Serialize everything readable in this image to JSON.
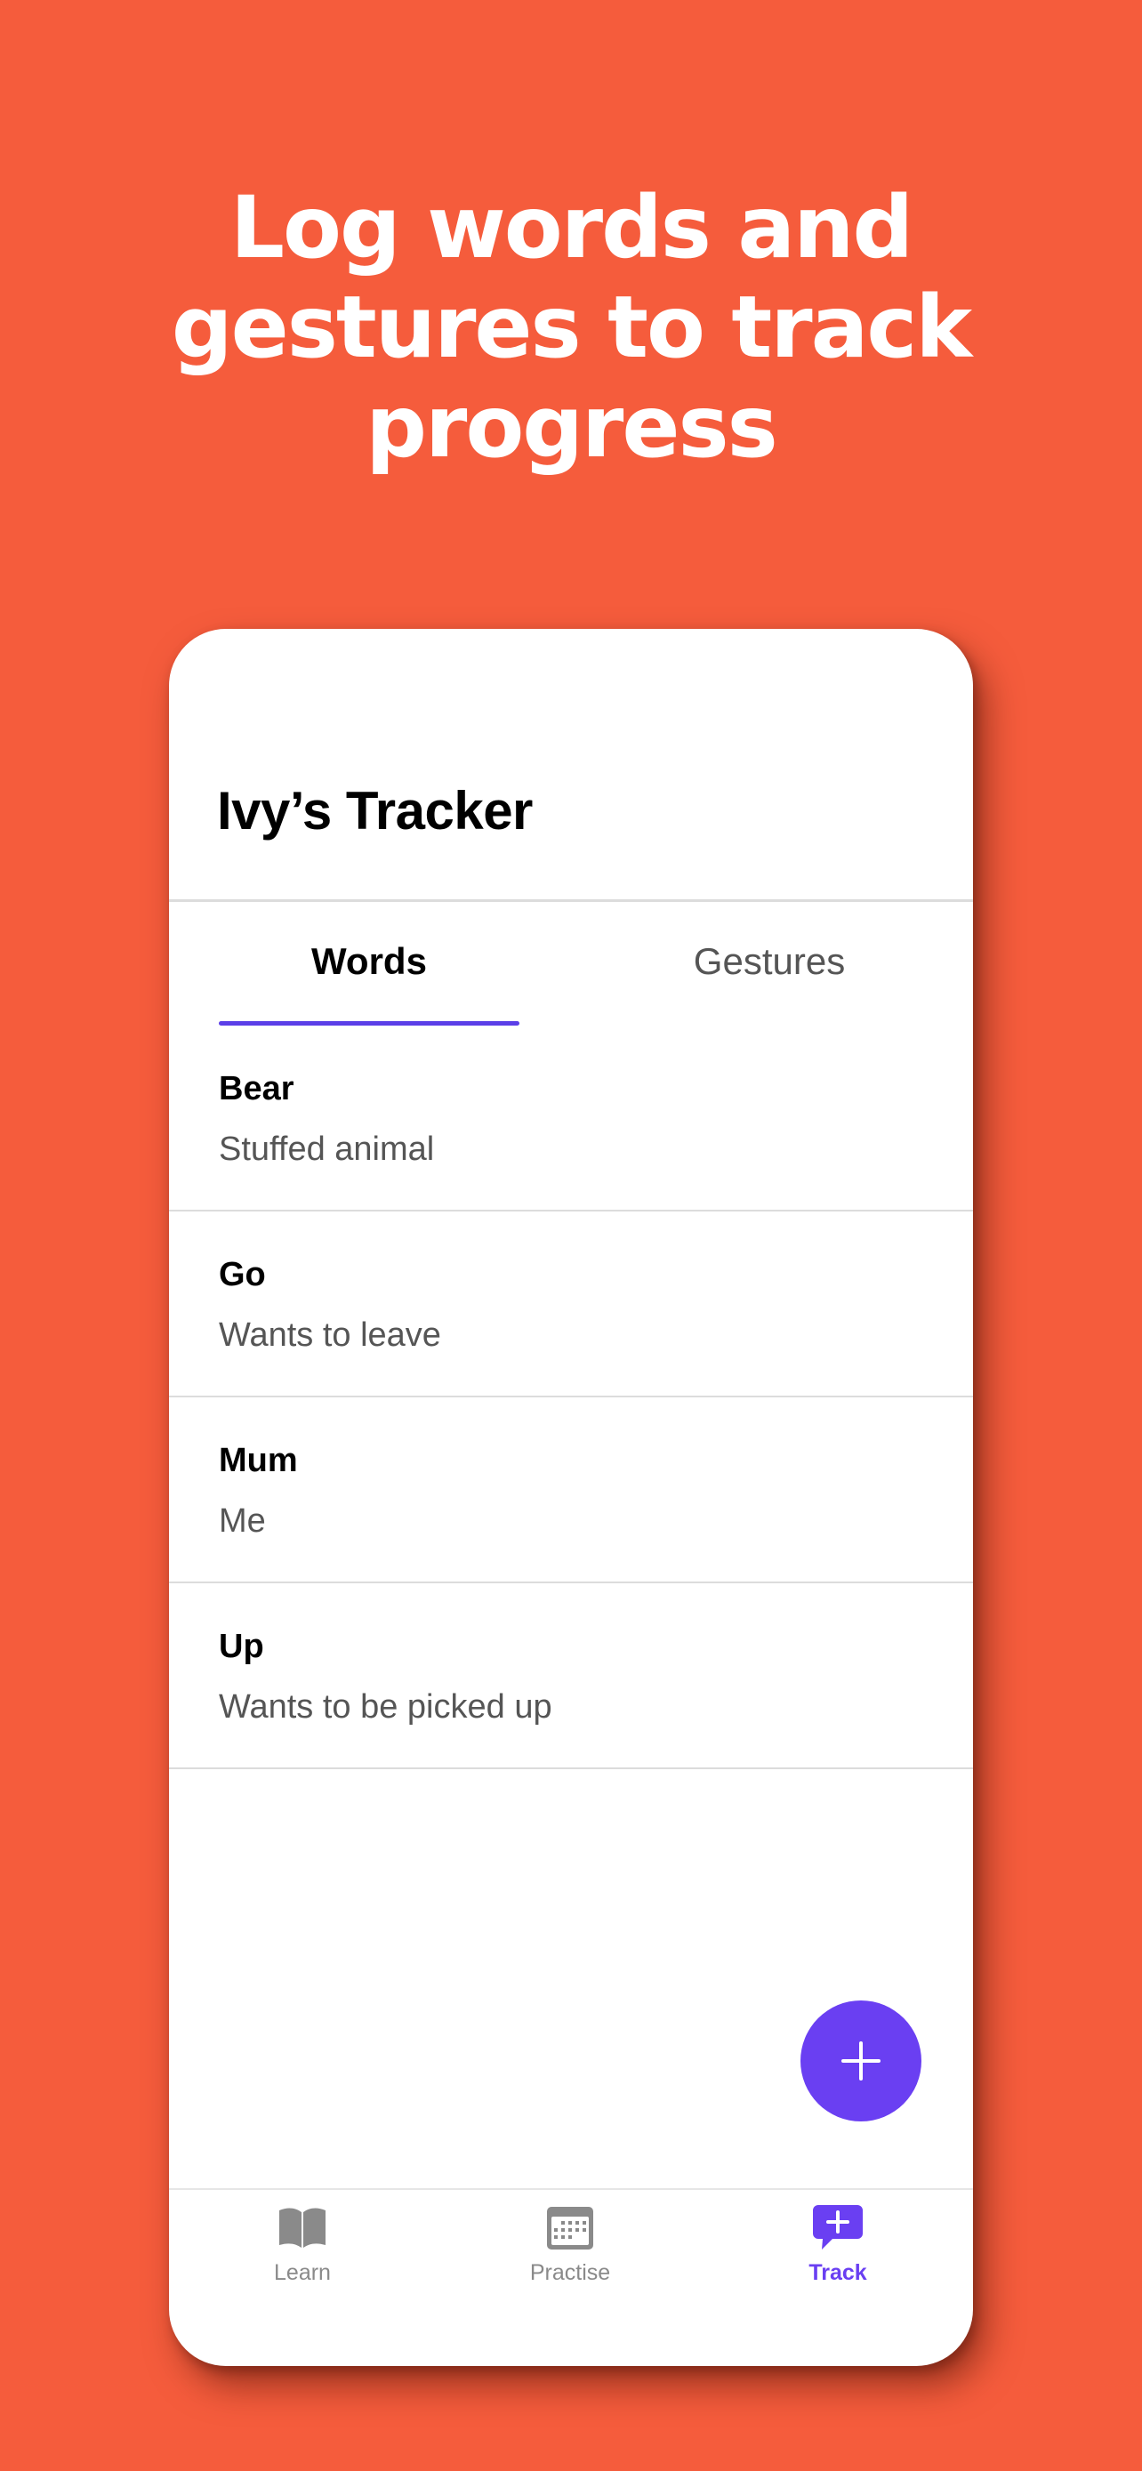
{
  "promo": {
    "headline_lines": [
      "Log words and",
      "gestures to track",
      "progress"
    ]
  },
  "app": {
    "title": "Ivy’s Tracker",
    "tabs": [
      {
        "label": "Words",
        "active": true
      },
      {
        "label": "Gestures",
        "active": false
      }
    ],
    "words": [
      {
        "word": "Bear",
        "meaning": "Stuffed animal"
      },
      {
        "word": "Go",
        "meaning": "Wants to leave"
      },
      {
        "word": "Mum",
        "meaning": "Me"
      },
      {
        "word": "Up",
        "meaning": "Wants to be picked up"
      }
    ],
    "fab": {
      "icon": "plus-icon"
    },
    "bottom_nav": [
      {
        "label": "Learn",
        "icon": "book-icon",
        "active": false
      },
      {
        "label": "Practise",
        "icon": "calendar-icon",
        "active": false
      },
      {
        "label": "Track",
        "icon": "chat-plus-icon",
        "active": true
      }
    ]
  },
  "colors": {
    "background": "#F55C3C",
    "accent": "#6A3FF2",
    "tab_indicator": "#5B3FE8",
    "text_primary": "#000000",
    "text_secondary": "#555555",
    "nav_inactive": "#8a8a8a"
  }
}
